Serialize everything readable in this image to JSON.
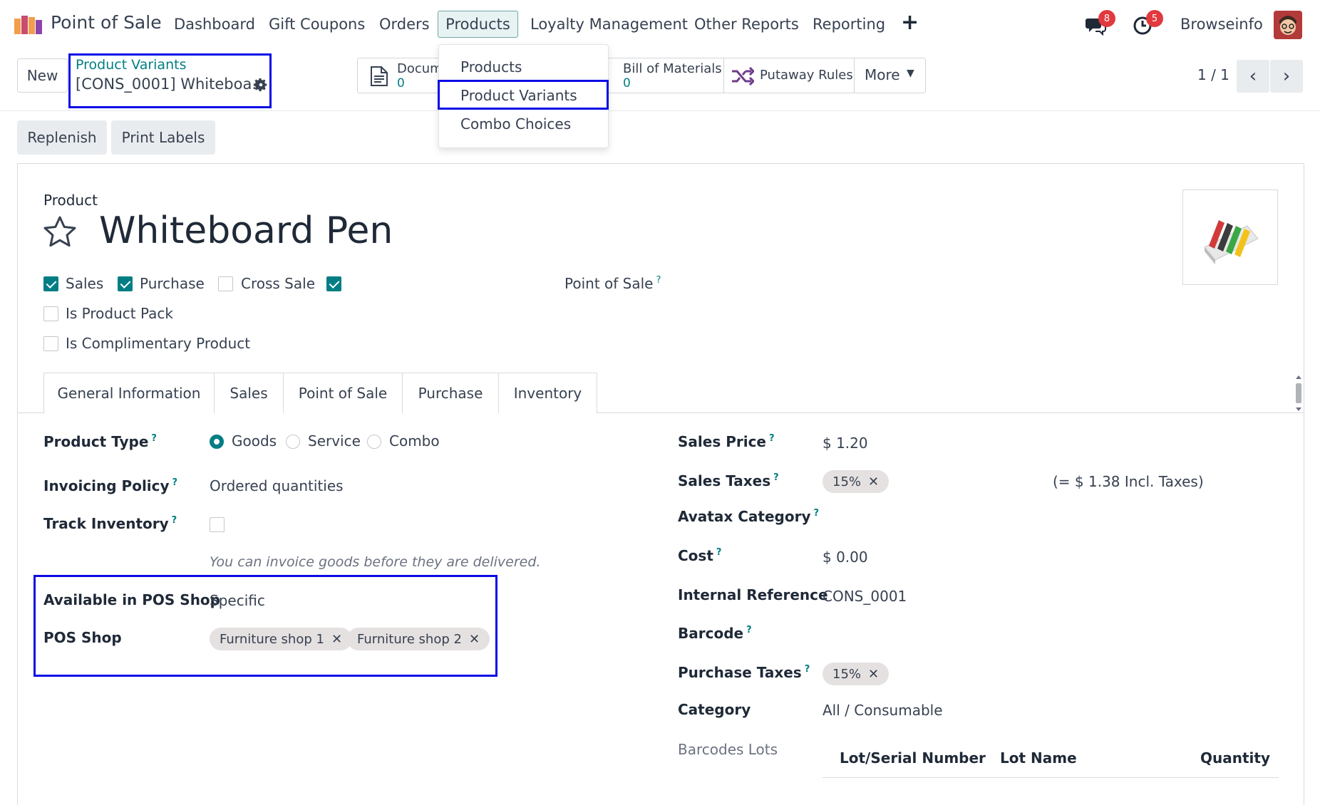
{
  "navbar": {
    "app_name": "Point of Sale",
    "menus": [
      "Dashboard",
      "Gift Coupons",
      "Orders",
      "Products",
      "Loyalty Management",
      "Other Reports",
      "Reporting"
    ],
    "plus": "+",
    "messages_count": "8",
    "activities_count": "5",
    "company": "Browseinfo"
  },
  "products_dropdown": {
    "items": [
      "Products",
      "Product Variants",
      "Combo Choices"
    ]
  },
  "control": {
    "new_label": "New",
    "breadcrumb_link": "Product Variants",
    "breadcrumb_current": "[CONS_0001] Whiteboa…",
    "smart_buttons": {
      "documents": {
        "label": "Docum",
        "value": "0"
      },
      "bom": {
        "label": "Bill of Materials",
        "value": "0"
      },
      "putaway": {
        "label": "Putaway Rules"
      },
      "more": {
        "label": "More"
      }
    },
    "pager": "1 / 1"
  },
  "actions": {
    "replenish": "Replenish",
    "print_labels": "Print Labels"
  },
  "form": {
    "product_label": "Product",
    "name": "Whiteboard Pen",
    "checkboxes": {
      "sales": "Sales",
      "purchase": "Purchase",
      "cross_sale": "Cross Sale",
      "pos_label": "Point of Sale",
      "is_product_pack": "Is Product Pack",
      "is_complimentary": "Is Complimentary Product"
    },
    "tabs": [
      "General Information",
      "Sales",
      "Point of Sale",
      "Purchase",
      "Inventory"
    ],
    "left": {
      "product_type_label": "Product Type",
      "product_type_options": [
        "Goods",
        "Service",
        "Combo"
      ],
      "invoicing_policy_label": "Invoicing Policy",
      "invoicing_policy_value": "Ordered quantities",
      "track_inventory_label": "Track Inventory",
      "hint": "You can invoice goods before they are delivered.",
      "available_pos_label": "Available in POS Shop",
      "available_pos_value": "Specific",
      "pos_shop_label": "POS Shop",
      "pos_shop_tags": [
        "Furniture shop 1",
        "Furniture shop 2"
      ]
    },
    "right": {
      "sales_price_label": "Sales Price",
      "sales_price_value": "$ 1.20",
      "sales_taxes_label": "Sales Taxes",
      "sales_taxes_tag": "15%",
      "incl_taxes": "(= $ 1.38 Incl. Taxes)",
      "avatax_label": "Avatax Category",
      "cost_label": "Cost",
      "cost_value": "$ 0.00",
      "internal_ref_label": "Internal Reference",
      "internal_ref_value": "CONS_0001",
      "barcode_label": "Barcode",
      "purchase_taxes_label": "Purchase Taxes",
      "purchase_taxes_tag": "15%",
      "category_label": "Category",
      "category_value": "All / Consumable",
      "barcodes_lots_label": "Barcodes Lots",
      "lots_columns": [
        "Lot/Serial Number",
        "Lot Name",
        "Quantity"
      ]
    }
  },
  "colors": {
    "accent": "#017e84",
    "highlight": "#0a0ae6",
    "badge": "#e0393e"
  }
}
